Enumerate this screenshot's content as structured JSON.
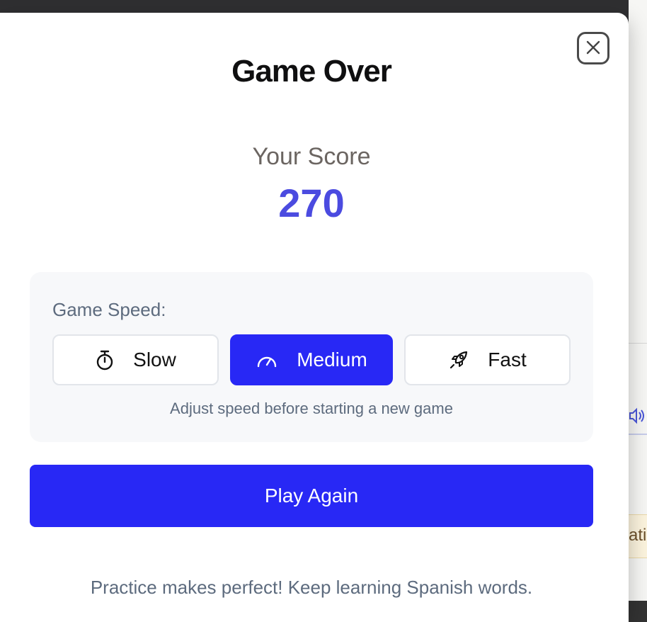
{
  "dialog": {
    "title": "Game Over",
    "close_icon": "close-icon"
  },
  "score": {
    "label": "Your Score",
    "value": "270"
  },
  "speed": {
    "label": "Game Speed:",
    "options": [
      {
        "label": "Slow",
        "icon": "stopwatch-icon",
        "selected": false
      },
      {
        "label": "Medium",
        "icon": "gauge-icon",
        "selected": true
      },
      {
        "label": "Fast",
        "icon": "rocket-icon",
        "selected": false
      }
    ],
    "hint": "Adjust speed before starting a new game"
  },
  "actions": {
    "play_again_label": "Play Again"
  },
  "footer": {
    "message": "Practice makes perfect! Keep learning Spanish words."
  },
  "background": {
    "partial_text": "atic"
  },
  "colors": {
    "accent": "#2828f5",
    "score": "#4b4be0",
    "muted_text": "#5d6b7e",
    "panel_bg": "#f7f8fa"
  }
}
